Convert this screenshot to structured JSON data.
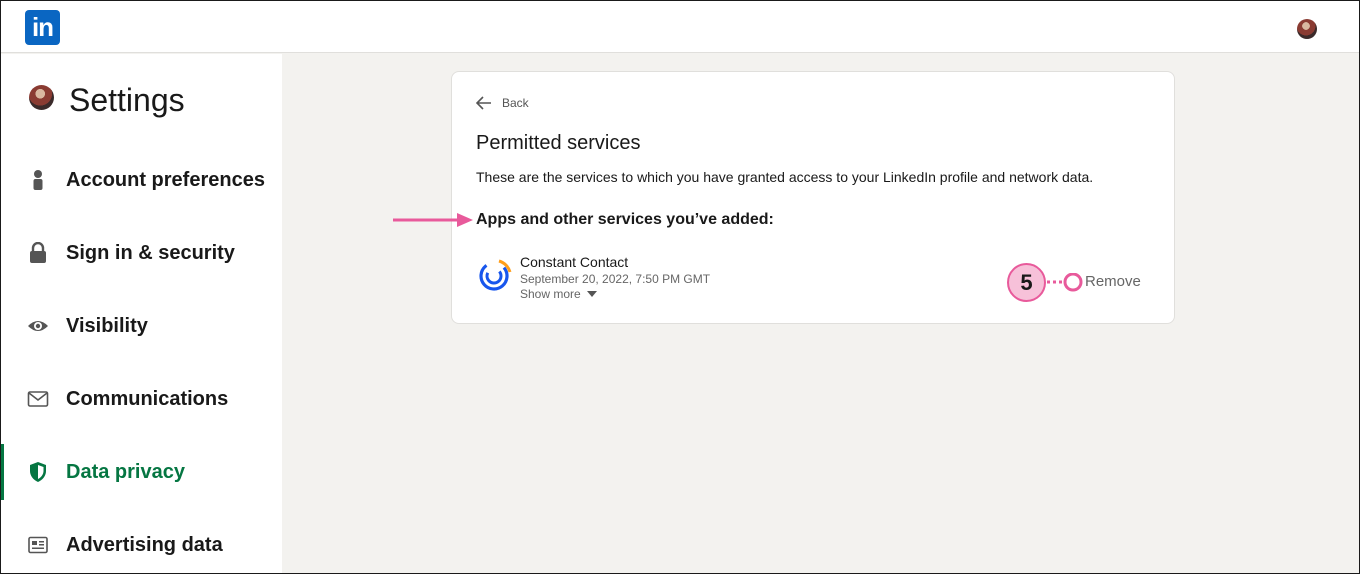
{
  "header": {
    "logo_text": "in"
  },
  "sidebar": {
    "title": "Settings",
    "items": [
      {
        "label": "Account preferences",
        "icon": "person-icon"
      },
      {
        "label": "Sign in & security",
        "icon": "lock-icon"
      },
      {
        "label": "Visibility",
        "icon": "eye-icon"
      },
      {
        "label": "Communications",
        "icon": "envelope-icon"
      },
      {
        "label": "Data privacy",
        "icon": "shield-icon",
        "active": true
      },
      {
        "label": "Advertising data",
        "icon": "newspaper-icon"
      }
    ]
  },
  "main": {
    "back_label": "Back",
    "title": "Permitted services",
    "description": "These are the services to which you have granted access to your LinkedIn profile and network data.",
    "subheading": "Apps and other services you’ve added:",
    "service": {
      "name": "Constant Contact",
      "date": "September 20, 2022, 7:50 PM GMT",
      "show_more": "Show more",
      "remove_label": "Remove",
      "icon": "constant-contact-icon"
    }
  },
  "annotation": {
    "step": "5",
    "color": "#e85a9b"
  },
  "colors": {
    "brand": "#0a66c2",
    "active_nav": "#057642",
    "page_background": "#f3f2ef"
  }
}
